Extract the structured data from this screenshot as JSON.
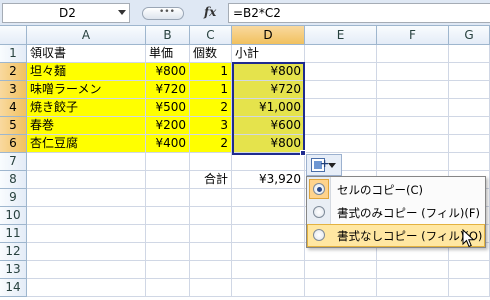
{
  "formula_bar": {
    "name_box": "D2",
    "formula": "=B2*C2"
  },
  "columns": [
    "A",
    "B",
    "C",
    "D",
    "E",
    "F",
    "G"
  ],
  "rows": [
    "1",
    "2",
    "3",
    "4",
    "5",
    "6",
    "7",
    "8",
    "9",
    "10",
    "11",
    "12",
    "13",
    "14"
  ],
  "cells": {
    "A1": "領収書",
    "B1": "単価",
    "C1": "個数",
    "D1": "小計",
    "A2": "坦々麺",
    "B2": "¥800",
    "C2": "1",
    "D2": "¥800",
    "A3": "味噌ラーメン",
    "B3": "¥720",
    "C3": "1",
    "D3": "¥720",
    "A4": "焼き餃子",
    "B4": "¥500",
    "C4": "2",
    "D4": "¥1,000",
    "A5": "春巻",
    "B5": "¥200",
    "C5": "3",
    "D5": "¥600",
    "A6": "杏仁豆腐",
    "B6": "¥400",
    "C6": "2",
    "D6": "¥800",
    "C8": "合計",
    "D8": "¥3,920"
  },
  "paste_menu": {
    "items": [
      {
        "label": "セルのコピー(C)",
        "checked": true
      },
      {
        "label": "書式のみコピー (フィル)(F)",
        "checked": false
      },
      {
        "label": "書式なしコピー (フィル)(O)",
        "checked": false
      }
    ]
  },
  "colors": {
    "highlight": "#ffff00",
    "selection": "#e5e34c",
    "selection_border": "#1f2b8f"
  }
}
